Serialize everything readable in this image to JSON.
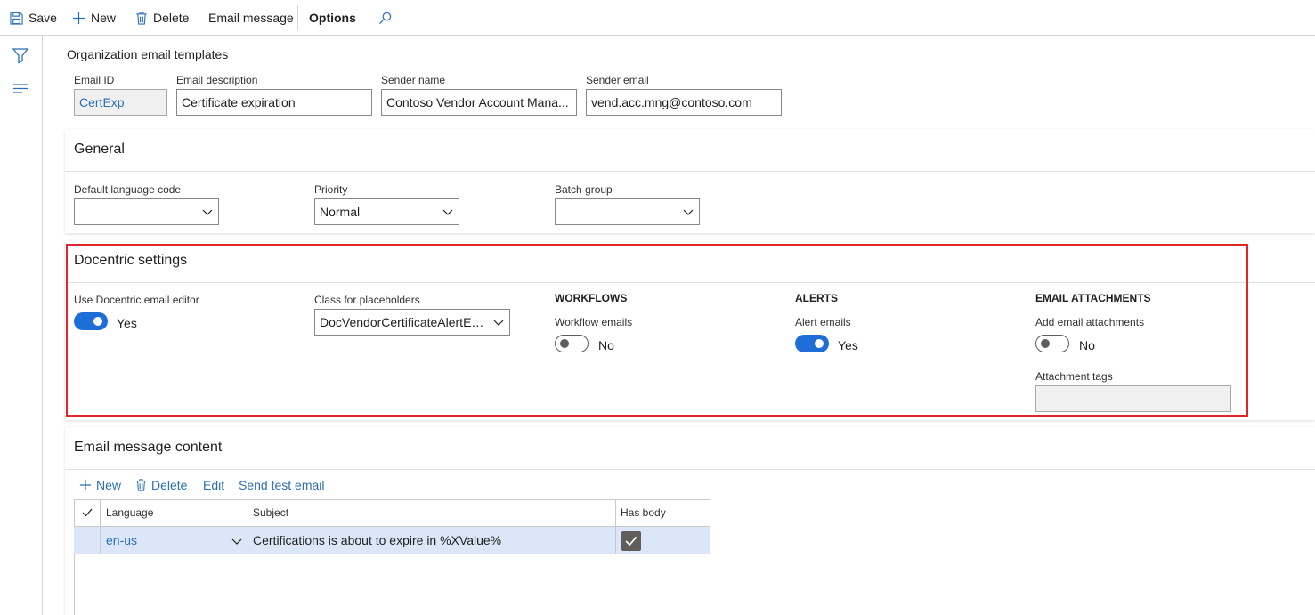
{
  "toolbar": {
    "save": "Save",
    "new": "New",
    "delete": "Delete",
    "email_message": "Email message",
    "options": "Options"
  },
  "page": {
    "title": "Organization email templates"
  },
  "header_fields": {
    "email_id": {
      "label": "Email ID",
      "value": "CertExp"
    },
    "email_description": {
      "label": "Email description",
      "value": "Certificate expiration"
    },
    "sender_name": {
      "label": "Sender name",
      "value": "Contoso Vendor Account Mana..."
    },
    "sender_email": {
      "label": "Sender email",
      "value": "vend.acc.mng@contoso.com"
    }
  },
  "general": {
    "title": "General",
    "default_language_code": {
      "label": "Default language code",
      "value": ""
    },
    "priority": {
      "label": "Priority",
      "value": "Normal"
    },
    "batch_group": {
      "label": "Batch group",
      "value": ""
    }
  },
  "docentric": {
    "title": "Docentric settings",
    "use_editor": {
      "label": "Use Docentric email editor",
      "state": "Yes",
      "on": true
    },
    "class_placeholders": {
      "label": "Class for placeholders",
      "value": "DocVendorCertificateAlertEm..."
    },
    "workflows": {
      "heading": "WORKFLOWS",
      "label": "Workflow emails",
      "state": "No",
      "on": false
    },
    "alerts": {
      "heading": "ALERTS",
      "label": "Alert emails",
      "state": "Yes",
      "on": true
    },
    "attachments": {
      "heading": "EMAIL ATTACHMENTS",
      "label": "Add email attachments",
      "state": "No",
      "on": false,
      "tags_label": "Attachment tags",
      "tags_value": ""
    }
  },
  "email_content": {
    "title": "Email message content",
    "actions": {
      "new": "New",
      "delete": "Delete",
      "edit": "Edit",
      "send_test": "Send test email"
    },
    "columns": {
      "language": "Language",
      "subject": "Subject",
      "has_body": "Has body"
    },
    "rows": [
      {
        "language": "en-us",
        "subject": "Certifications is about to expire in %XValue%",
        "has_body": true
      }
    ]
  },
  "colors": {
    "accent": "#1e6ed8",
    "link": "#2b6fb5",
    "highlight": "#e0262a",
    "row_selected": "#dbe7f8"
  },
  "icons": [
    "save-icon",
    "plus-icon",
    "trash-icon",
    "search-icon",
    "filter-icon",
    "lines-icon",
    "chevron-down-icon",
    "checkmark-icon"
  ]
}
